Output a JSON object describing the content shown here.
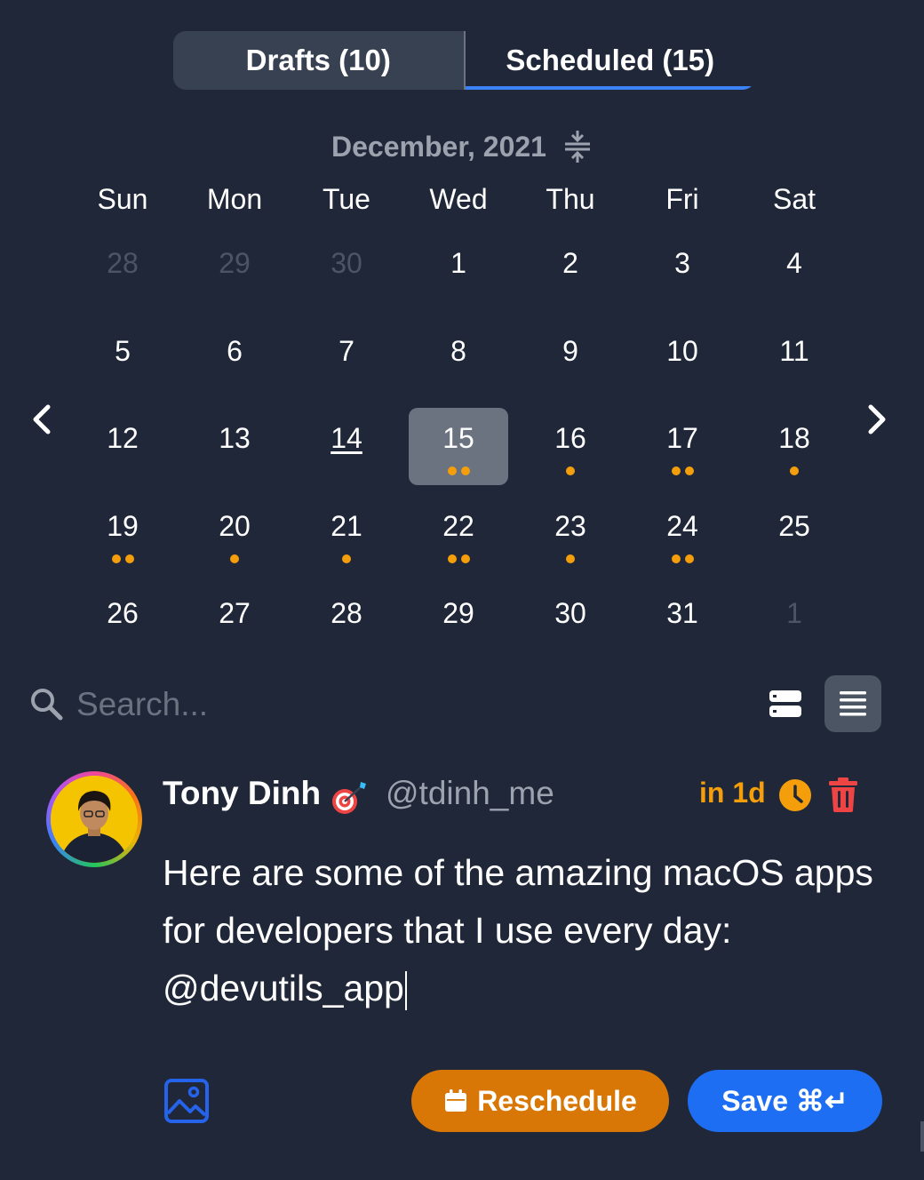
{
  "tabs": [
    {
      "label": "Drafts (10)",
      "active": false
    },
    {
      "label": "Scheduled (15)",
      "active": true
    }
  ],
  "calendar": {
    "month_title": "December, 2021",
    "weekdays": [
      "Sun",
      "Mon",
      "Tue",
      "Wed",
      "Thu",
      "Fri",
      "Sat"
    ],
    "weeks": [
      [
        {
          "d": "28",
          "muted": true,
          "dots": 0
        },
        {
          "d": "29",
          "muted": true,
          "dots": 0
        },
        {
          "d": "30",
          "muted": true,
          "dots": 0
        },
        {
          "d": "1",
          "dots": 0
        },
        {
          "d": "2",
          "dots": 0
        },
        {
          "d": "3",
          "dots": 0
        },
        {
          "d": "4",
          "dots": 0
        }
      ],
      [
        {
          "d": "5",
          "dots": 0
        },
        {
          "d": "6",
          "dots": 0
        },
        {
          "d": "7",
          "dots": 0
        },
        {
          "d": "8",
          "dots": 0
        },
        {
          "d": "9",
          "dots": 0
        },
        {
          "d": "10",
          "dots": 0
        },
        {
          "d": "11",
          "dots": 0
        }
      ],
      [
        {
          "d": "12",
          "dots": 0
        },
        {
          "d": "13",
          "dots": 0
        },
        {
          "d": "14",
          "today": true,
          "dots": 0
        },
        {
          "d": "15",
          "selected": true,
          "dots": 2
        },
        {
          "d": "16",
          "dots": 1
        },
        {
          "d": "17",
          "dots": 2
        },
        {
          "d": "18",
          "dots": 1
        }
      ],
      [
        {
          "d": "19",
          "dots": 2
        },
        {
          "d": "20",
          "dots": 1
        },
        {
          "d": "21",
          "dots": 1
        },
        {
          "d": "22",
          "dots": 2
        },
        {
          "d": "23",
          "dots": 1
        },
        {
          "d": "24",
          "dots": 2
        },
        {
          "d": "25",
          "dots": 0
        }
      ],
      [
        {
          "d": "26",
          "dots": 0
        },
        {
          "d": "27",
          "dots": 0
        },
        {
          "d": "28",
          "dots": 0
        },
        {
          "d": "29",
          "dots": 0
        },
        {
          "d": "30",
          "dots": 0
        },
        {
          "d": "31",
          "dots": 0
        },
        {
          "d": "1",
          "muted": true,
          "dots": 0
        }
      ]
    ]
  },
  "search": {
    "placeholder": "Search...",
    "value": ""
  },
  "view_modes": [
    {
      "name": "card-view",
      "icon": "stacked-cards-icon",
      "active": false
    },
    {
      "name": "list-view",
      "icon": "list-lines-icon",
      "active": true
    }
  ],
  "tweet": {
    "author_name": "Tony Dinh",
    "author_badge_icon": "dart-target-icon",
    "handle": "@tdinh_me",
    "relative_time": "in 1d",
    "body": "Here are some of the amazing macOS apps for developers that I use every day: @devutils_app"
  },
  "actions": {
    "reschedule_label": "Reschedule",
    "save_label": "Save ⌘↵"
  },
  "colors": {
    "background": "#1f2738",
    "accent_blue": "#1d6ef3",
    "accent_orange": "#d97706",
    "dot_orange": "#f59e0b",
    "delete_red": "#ef4444"
  }
}
